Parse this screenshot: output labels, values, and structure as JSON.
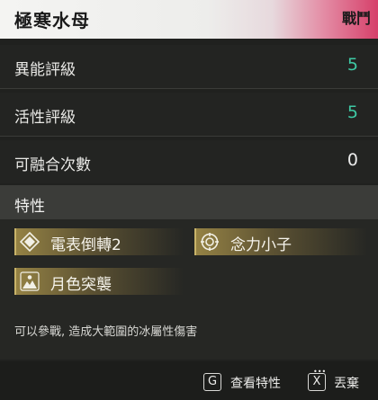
{
  "header": {
    "title": "極寒水母",
    "tag": "戰鬥"
  },
  "stats": [
    {
      "label": "異能評級",
      "value": "5",
      "value_color": "#3ec9a4"
    },
    {
      "label": "活性評級",
      "value": "5",
      "value_color": "#3ec9a4"
    },
    {
      "label": "可融合次數",
      "value": "0",
      "value_color": "#ececec"
    }
  ],
  "traits": {
    "heading": "特性",
    "items": [
      {
        "label": "電表倒轉2",
        "icon": "diamond-icon"
      },
      {
        "label": "念力小子",
        "icon": "target-gear-icon"
      },
      {
        "label": "月色突襲",
        "icon": "mountain-figure-icon"
      }
    ]
  },
  "description": "可以參戰, 造成大範圍的冰屬性傷害",
  "footer": {
    "actions": [
      {
        "key": "G",
        "label": "查看特性"
      },
      {
        "key": "X",
        "label": "丟棄"
      }
    ]
  },
  "colors": {
    "accent": "#3ec9a4",
    "trait_gold": "#c9b46a",
    "header_pink": "#d6406a"
  }
}
